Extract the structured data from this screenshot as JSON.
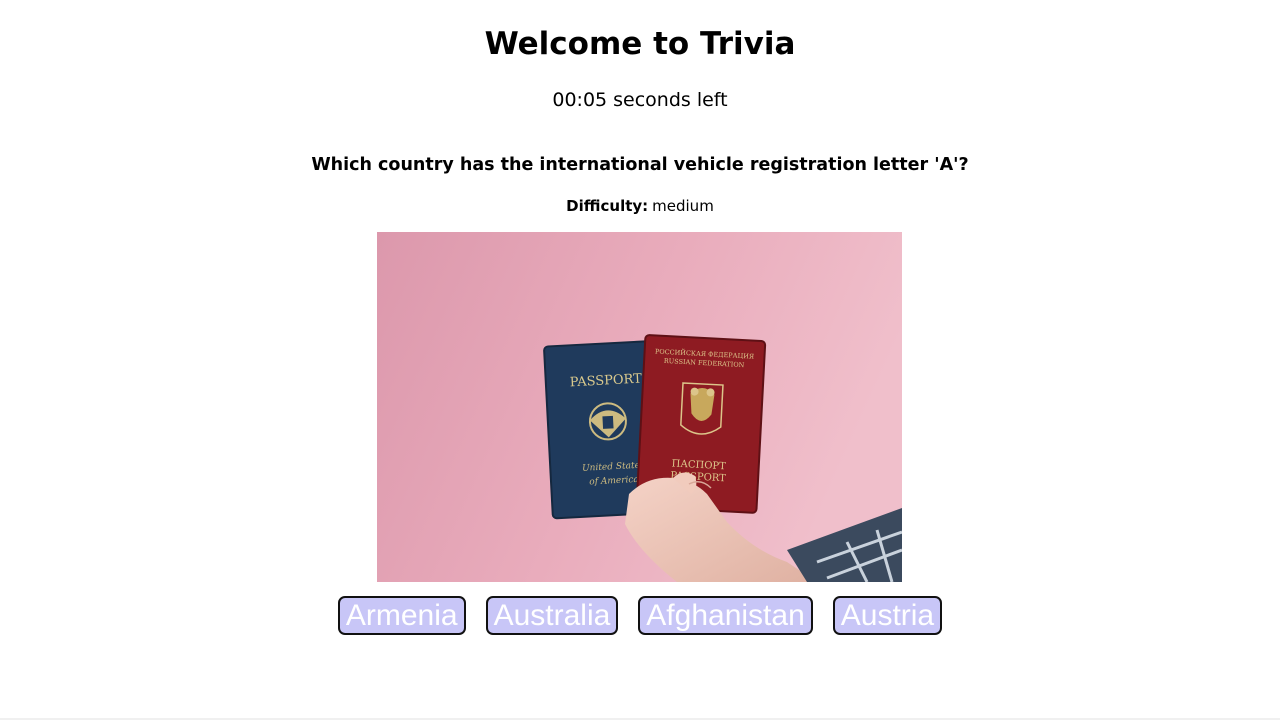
{
  "header": {
    "title": "Welcome to Trivia"
  },
  "timer": {
    "value": "00:05",
    "unit_text": "seconds left"
  },
  "question": {
    "text": "Which country has the international vehicle registration letter 'A'?",
    "difficulty_label": "Difficulty:",
    "difficulty_value": "medium",
    "image": {
      "subject": "hand holding a US passport and a Russian Federation passport against a pink background",
      "us_passport_text": "PASSPORT",
      "us_passport_sub": "United States of America",
      "ru_passport_top": "РОССИЙСКАЯ ФЕДЕРАЦИЯ RUSSIAN FEDERATION",
      "ru_passport_bottom": "ПАСПОРТ PASSPORT"
    }
  },
  "answers": [
    {
      "label": "Armenia"
    },
    {
      "label": "Australia"
    },
    {
      "label": "Afghanistan"
    },
    {
      "label": "Austria"
    }
  ],
  "colors": {
    "answer_button_bg": "#c8c6f7",
    "answer_button_text": "#ffffff",
    "photo_background": "#e8aab8",
    "us_passport": "#1f3a5c",
    "ru_passport": "#8e1b22"
  }
}
